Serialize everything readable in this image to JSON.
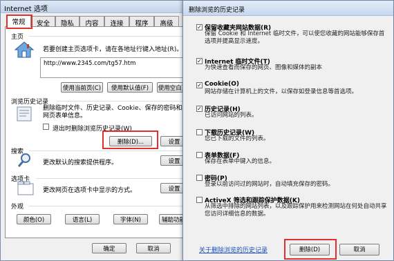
{
  "left_window": {
    "title": "Internet 选项",
    "tabs": [
      "常规",
      "安全",
      "隐私",
      "内容",
      "连接",
      "程序",
      "高级"
    ],
    "home": {
      "heading": "主页",
      "desc": "若要创建主页选项卡，请在各地址行键入地址(R)。",
      "url": "http://www.2345.com/tg57.htm",
      "btn_current": "使用当前页(C)",
      "btn_default": "使用默认值(F)",
      "btn_blank": "使用空白页"
    },
    "history": {
      "heading": "浏览历史记录",
      "desc": "删除临时文件、历史记录、Cookie、保存的密码和网页表单信息。",
      "exit_checkbox": "退出时删除浏览历史记录(W)",
      "btn_delete": "删除(D)...",
      "btn_settings": "设置"
    },
    "search": {
      "heading": "搜索",
      "desc": "更改默认的搜索提供程序。",
      "btn_settings": "设置"
    },
    "tabs_section": {
      "heading": "选项卡",
      "desc": "更改网页在选项卡中显示的方式。",
      "btn_settings": "设置"
    },
    "appearance": {
      "heading": "外观",
      "btn_colors": "颜色(O)",
      "btn_languages": "语言(L)",
      "btn_fonts": "字体(N)",
      "btn_accessibility": "辅助功能"
    },
    "footer": {
      "ok": "确定",
      "cancel": "取消"
    }
  },
  "right_window": {
    "title": "删除浏览的历史记录",
    "options": [
      {
        "title": "保留收藏夹网站数据(R)",
        "desc": "保留 Cookie 和 Internet 临时文件，可以使您收藏的网站能够保存首选项并提高显示速度。",
        "checked": true
      },
      {
        "title": "Internet 临时文件(T)",
        "desc": "为快速查看而保存的网页、图像和媒体的副本",
        "checked": true
      },
      {
        "title": "Cookie(O)",
        "desc": "网站存储在计算机上的文件，以保存如登录信息等首选项。",
        "checked": true
      },
      {
        "title": "历史记录(H)",
        "desc": "已访问网站的列表。",
        "checked": true
      },
      {
        "title": "下载历史记录(W)",
        "desc": "您已下载的文件的列表。",
        "checked": false
      },
      {
        "title": "表单数据(F)",
        "desc": "保存在表单中键入的信息。",
        "checked": false
      },
      {
        "title": "密码(P)",
        "desc": "登录以前访问过的网站时，自动填充保存的密码。",
        "checked": false
      },
      {
        "title": "ActiveX 筛选和跟踪保护数据(K)",
        "desc": "从筛选中排除的网站列表，以及跟踪保护用来检测网站在何处自动共享您访问详细信息的数据。",
        "checked": false
      }
    ],
    "link": "关于删除浏览的历史记录",
    "btn_delete": "删除(D)",
    "btn_cancel": "取消"
  },
  "colors": {
    "highlight_red": "#e0302c",
    "link_blue": "#1a4fc2"
  }
}
